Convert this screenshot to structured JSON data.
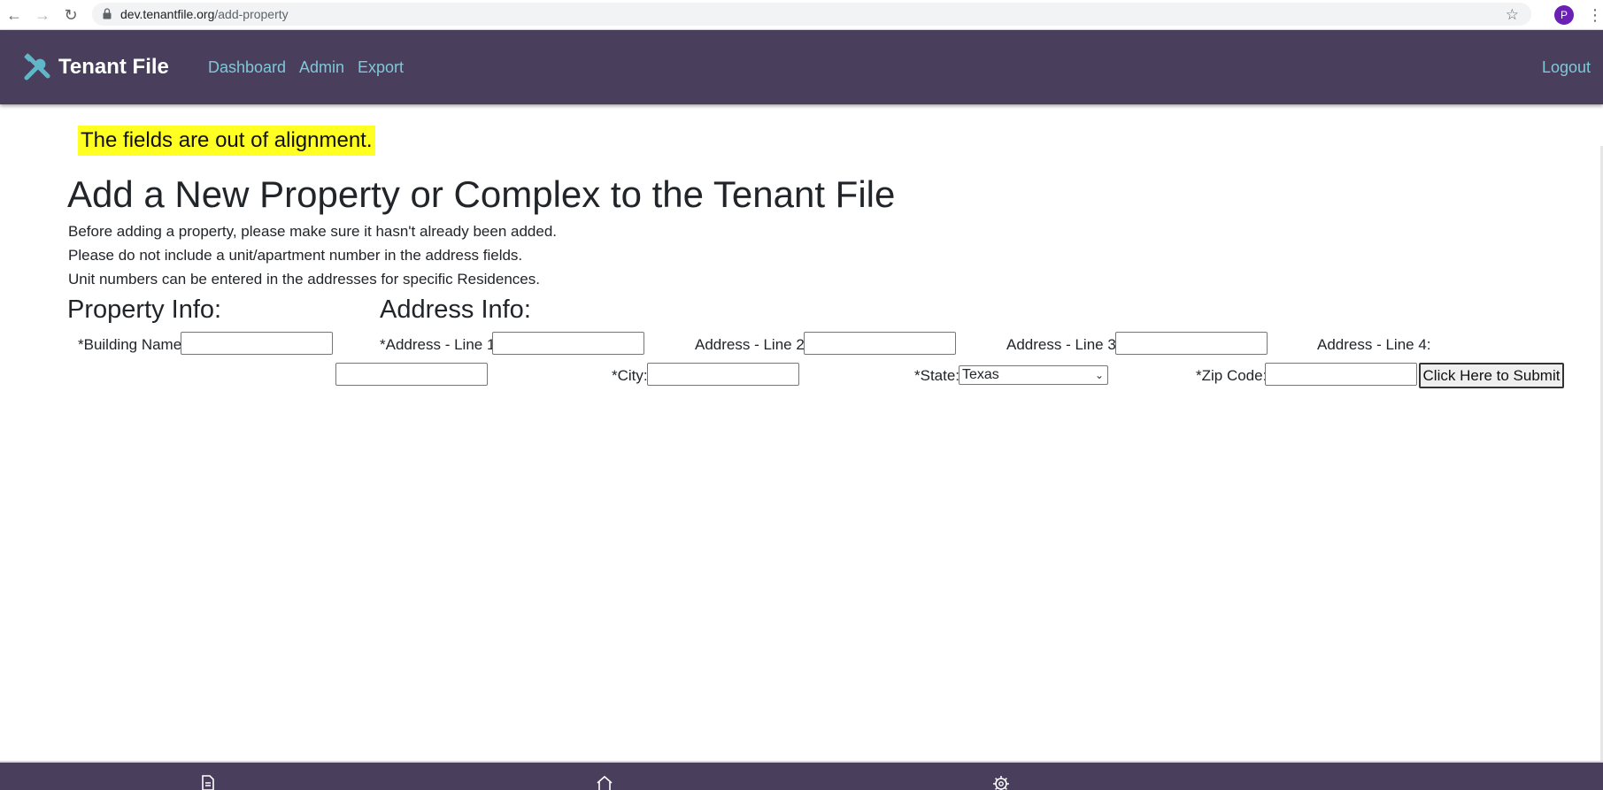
{
  "browser": {
    "url_host": "dev.tenantfile.org",
    "url_path": "/add-property",
    "profile_initial": "P"
  },
  "navbar": {
    "brand": "Tenant File",
    "links": [
      "Dashboard",
      "Admin",
      "Export"
    ],
    "logout": "Logout"
  },
  "note": "The fields are out of alignment.",
  "page": {
    "title": "Add a New Property or Complex to the Tenant File",
    "descriptions": [
      "Before adding a property, please make sure it hasn't already been added.",
      "Please do not include a unit/apartment number in the address fields.",
      "Unit numbers can be entered in the addresses for specific Residences."
    ]
  },
  "form": {
    "property_heading": "Property Info:",
    "address_heading": "Address Info:",
    "labels": {
      "building_name": "*Building Name:",
      "address1": "*Address - Line 1:",
      "address2": "Address - Line 2:",
      "address3": "Address - Line 3:",
      "address4": "Address - Line 4:",
      "city": "*City:",
      "state": "*State:",
      "zip": "*Zip Code:"
    },
    "values": {
      "building_name": "",
      "address1": "",
      "address2": "",
      "address3": "",
      "address4": "",
      "city": "",
      "zip": ""
    },
    "state_selected": "Texas",
    "submit_label": "Click Here to Submit"
  },
  "bottom_bar": {
    "icons": [
      "document-icon",
      "home-icon",
      "gear-icon"
    ]
  },
  "colors": {
    "navbar_bg": "#493f5d",
    "link": "#7fc8d8",
    "highlight": "#ffff22"
  }
}
